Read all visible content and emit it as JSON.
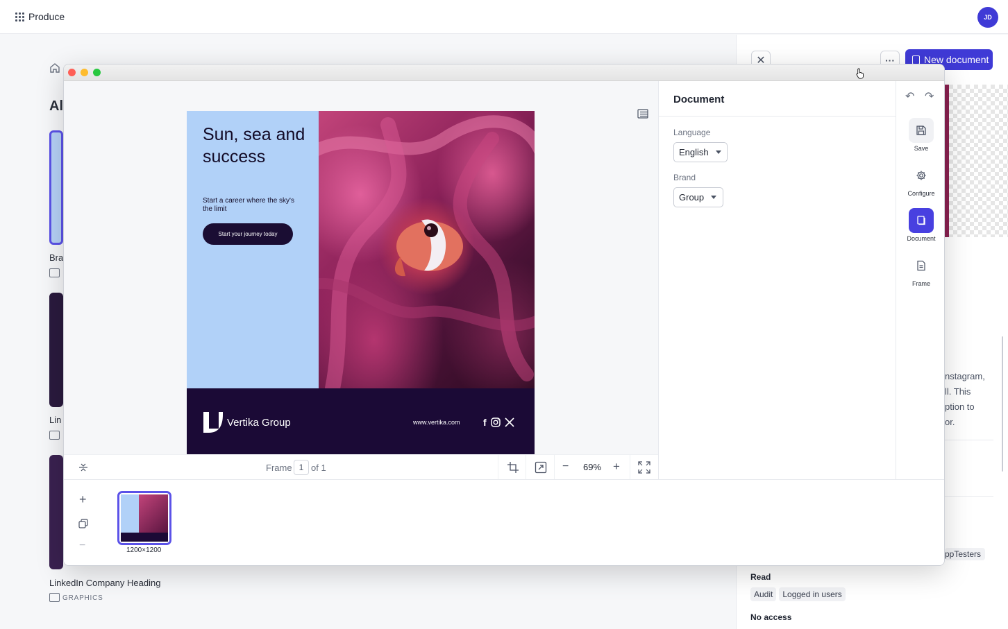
{
  "app": {
    "title": "Produce",
    "user_initials": "JD"
  },
  "background": {
    "heading": "Al",
    "cards": [
      {
        "label": "Bra"
      },
      {
        "label": "Lin"
      },
      {
        "label": "LinkedIn Company Heading",
        "type": "GRAPHICS"
      }
    ]
  },
  "right_panel": {
    "new_document_label": "New document",
    "description_lines": [
      "nstagram,",
      "ll. This",
      "ption to",
      "or."
    ],
    "testers_tag": "ppTesters",
    "read_label": "Read",
    "read_tags": [
      "Audit",
      "Logged in users"
    ],
    "no_access_label": "No access"
  },
  "design": {
    "headline": "Sun, sea and success",
    "subline": "Start a career where the sky's the limit",
    "cta": "Start your journey today",
    "brand": "Vertika Group",
    "website": "www.vertika.com",
    "social_icons": [
      "facebook-icon",
      "instagram-icon",
      "x-icon"
    ]
  },
  "toolbar": {
    "frame_label": "Frame",
    "frame_current": "1",
    "frame_total_label": "of 1",
    "zoom": "69%"
  },
  "frames": [
    {
      "size": "1200×1200",
      "selected": true
    }
  ],
  "document_panel": {
    "title": "Document",
    "language_label": "Language",
    "language_value": "English",
    "brand_label": "Brand",
    "brand_value": "Group"
  },
  "rail": {
    "items": [
      {
        "label": "Save",
        "icon": "save-icon"
      },
      {
        "label": "Configure",
        "icon": "gear-icon"
      },
      {
        "label": "Document",
        "icon": "document-icon",
        "active": true
      },
      {
        "label": "Frame",
        "icon": "frame-icon"
      }
    ]
  },
  "colors": {
    "accent": "#4840e0",
    "design_blue": "#b1d1f8",
    "design_navy": "#1b0a36"
  }
}
